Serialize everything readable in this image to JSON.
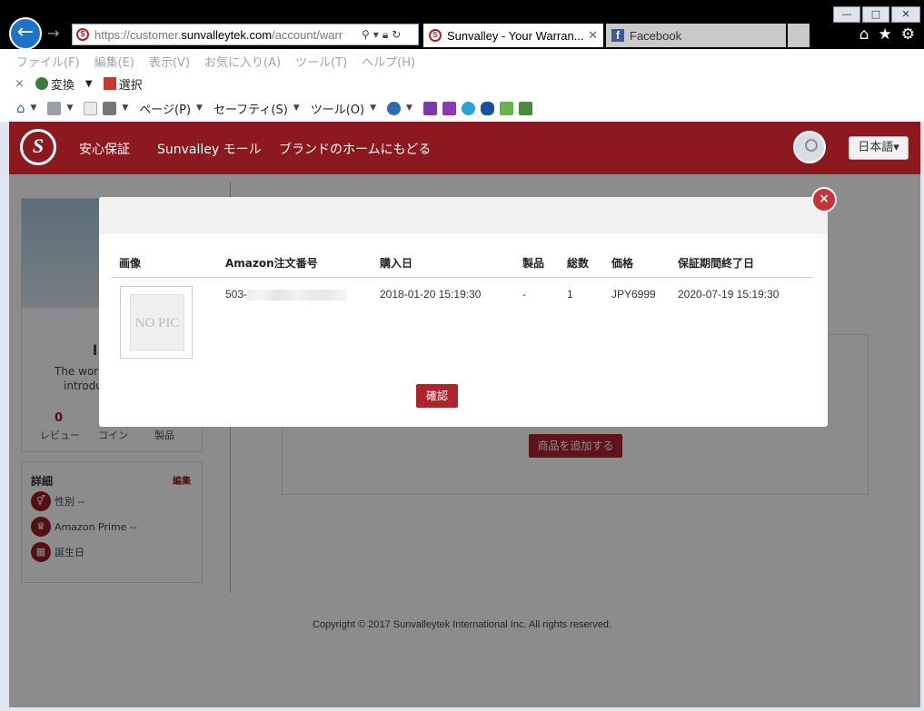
{
  "browser": {
    "url_prefix": "https://customer.",
    "url_domain": "sunvalleytek.com",
    "url_suffix": "/account/warr",
    "tabs": [
      {
        "label": "Sunvalley - Your Warran..."
      },
      {
        "label": "Facebook"
      }
    ],
    "window_controls": {
      "minimize": "—",
      "maximize": "□",
      "close": "✕"
    }
  },
  "menubar": [
    "ファイル(F)",
    "編集(E)",
    "表示(V)",
    "お気に入り(A)",
    "ツール(T)",
    "ヘルプ(H)"
  ],
  "favbar": {
    "close": "×",
    "convert_label": "変換",
    "select_label": "選択"
  },
  "cmdbar": {
    "page_label": "ページ(P)",
    "safety_label": "セーフティ(S)",
    "tools_label": "ツール(O)"
  },
  "site": {
    "logo": "S",
    "nav_links": [
      "安心保証",
      "Sunvalley モール",
      "ブランドのホームにもどる"
    ],
    "language": "日本語",
    "accent_color": "#8c1820"
  },
  "profile": {
    "name": "l",
    "intro_line1": "The worl",
    "intro_line2": "introdu",
    "stats": [
      {
        "value": "0",
        "label": "レビュー"
      },
      {
        "value": "",
        "label": "コイン"
      },
      {
        "value": "",
        "label": "製品"
      }
    ]
  },
  "details": {
    "title": "詳細",
    "edit": "編集",
    "rows": [
      {
        "icon": "gender-icon",
        "label": "性別",
        "value": "--"
      },
      {
        "icon": "crown-icon",
        "label": "Amazon Prime",
        "value": "--"
      },
      {
        "icon": "cake-icon",
        "label": "誕生日",
        "value": ""
      }
    ]
  },
  "right_panel": {
    "add_product": "商品を追加する"
  },
  "footer": "Copyright © 2017 Sunvalleytek International Inc. All rights reserved.",
  "modal": {
    "close": "×",
    "columns": [
      "画像",
      "Amazon注文番号",
      "購入日",
      "製品",
      "総数",
      "価格",
      "保証期間終了日"
    ],
    "row": {
      "image_text": "NO PIC",
      "order_prefix": "503-",
      "purchase_date": "2018-01-20 15:19:30",
      "product": "-",
      "quantity": "1",
      "price": "JPY6999",
      "warranty_end": "2020-07-19 15:19:30"
    },
    "confirm": "確認"
  }
}
